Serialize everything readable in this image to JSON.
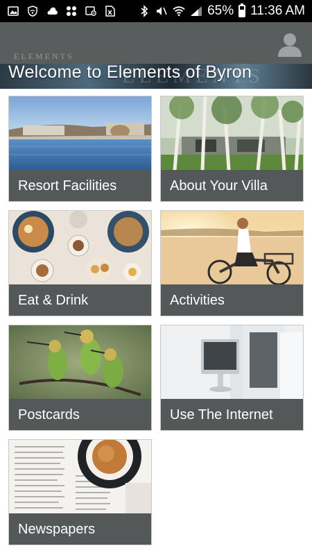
{
  "status_bar": {
    "battery": "65%",
    "battery_level": 0.65,
    "time": "11:36 AM",
    "icons_left": [
      "image-icon",
      "shield-wifi-icon",
      "weather-cloud-icon",
      "apps-grid-icon",
      "screen-share-icon",
      "excel-file-icon"
    ],
    "icons_right": [
      "bluetooth-icon",
      "mute-icon",
      "wifi-icon",
      "signal-icon",
      "battery-icon"
    ]
  },
  "header": {
    "title": "Welcome to Elements of Byron",
    "logo_small": "ELEMENTS",
    "logo_large": "ELEMENTS",
    "profile_icon": "user-avatar-icon"
  },
  "tiles": [
    {
      "label": "Resort Facilities",
      "image": "resort-pool-photo"
    },
    {
      "label": "About Your Villa",
      "image": "villa-trees-photo"
    },
    {
      "label": "Eat & Drink",
      "image": "food-table-photo"
    },
    {
      "label": "Activities",
      "image": "beach-bike-photo"
    },
    {
      "label": "Postcards",
      "image": "bee-eater-birds-photo"
    },
    {
      "label": "Use The Internet",
      "image": "computer-desk-photo"
    },
    {
      "label": "Newspapers",
      "image": "coffee-newspaper-photo"
    }
  ],
  "colors": {
    "header_bg": "#5a5d5e",
    "tile_label_bg": "#545859",
    "status_bg": "#000000"
  }
}
